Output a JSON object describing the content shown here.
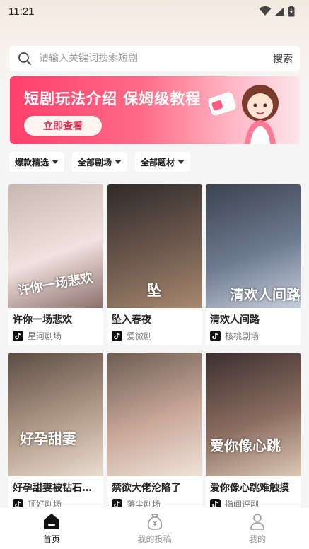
{
  "status": {
    "time": "11:21"
  },
  "search": {
    "placeholder": "请输入关键词搜索短剧",
    "button": "搜索"
  },
  "banner": {
    "title": "短剧玩法介绍 保姆级教程",
    "button": "立即查看"
  },
  "filters": [
    {
      "label": "爆款精选"
    },
    {
      "label": "全部剧场"
    },
    {
      "label": "全部题材"
    }
  ],
  "cards": [
    {
      "title": "许你一场悲欢",
      "source": "星河剧场",
      "poster_text": "许你一场悲欢",
      "colors": [
        "#c9b8b0",
        "#f1e2df",
        "#8d6f6b"
      ]
    },
    {
      "title": "坠入春夜",
      "source": "爱微剧",
      "poster_text": "坠",
      "colors": [
        "#2f2a2a",
        "#6e5a4e",
        "#a8886d"
      ]
    },
    {
      "title": "清欢人间路",
      "source": "核桃剧场",
      "poster_text": "清欢人间路",
      "colors": [
        "#3c4250",
        "#6d7a90",
        "#c7cfdd"
      ]
    },
    {
      "title": "好孕甜妻被钻石老公宠上天",
      "source": "顶好剧场",
      "poster_text": "好孕甜妻",
      "colors": [
        "#5a4c44",
        "#b29a88",
        "#e9ddd1"
      ]
    },
    {
      "title": "禁欲大佬沦陷了",
      "source": "落尘剧场",
      "poster_text": "",
      "colors": [
        "#6b5c52",
        "#caa999",
        "#efe3da"
      ]
    },
    {
      "title": "爱你像心跳难触摸",
      "source": "指间评剧",
      "poster_text": "爱你像心跳",
      "colors": [
        "#3b2f2f",
        "#8b6d60",
        "#dcc7b6"
      ]
    }
  ],
  "nav": [
    {
      "label": "首页",
      "icon": "home-icon",
      "active": true
    },
    {
      "label": "我的投稿",
      "icon": "money-bag-icon",
      "active": false
    },
    {
      "label": "我的",
      "icon": "user-icon",
      "active": false
    }
  ],
  "accent": "#ff3f6a"
}
